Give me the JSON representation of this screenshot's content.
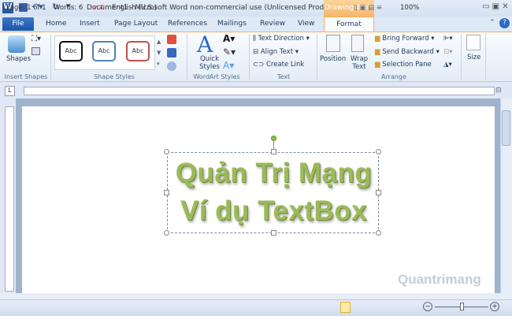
{
  "window": {
    "title": "Document1  -  Microsoft Word non-commercial use (Unlicensed Product)",
    "context_tab": "Drawing Tools"
  },
  "tabs": [
    "File",
    "Home",
    "Insert",
    "Page Layout",
    "References",
    "Mailings",
    "Review",
    "View",
    "Format"
  ],
  "ribbon": {
    "insert_shapes": {
      "label": "Insert Shapes",
      "shapes": "Shapes"
    },
    "shape_styles": {
      "label": "Shape Styles",
      "samples": [
        "Abc",
        "Abc",
        "Abc"
      ]
    },
    "wordart": {
      "label": "WordArt Styles",
      "quick_styles": "Quick Styles"
    },
    "text": {
      "label": "Text",
      "direction": "Text Direction",
      "align": "Align Text",
      "link": "Create Link"
    },
    "arrange": {
      "label": "Arrange",
      "position": "Position",
      "wrap": "Wrap Text",
      "forward": "Bring Forward",
      "backward": "Send Backward",
      "pane": "Selection Pane"
    },
    "size": {
      "label": "Size"
    }
  },
  "document": {
    "line1": "Quản Trị Mạng",
    "line2": "Ví dụ TextBox",
    "wordart_color": "#9bbb59"
  },
  "watermark": "Quantrimang",
  "status": {
    "page": "Page: 1 of 1",
    "words": "Words: 6",
    "language": "English (U.S.)",
    "zoom": "100%",
    "zoom_level": 100
  }
}
